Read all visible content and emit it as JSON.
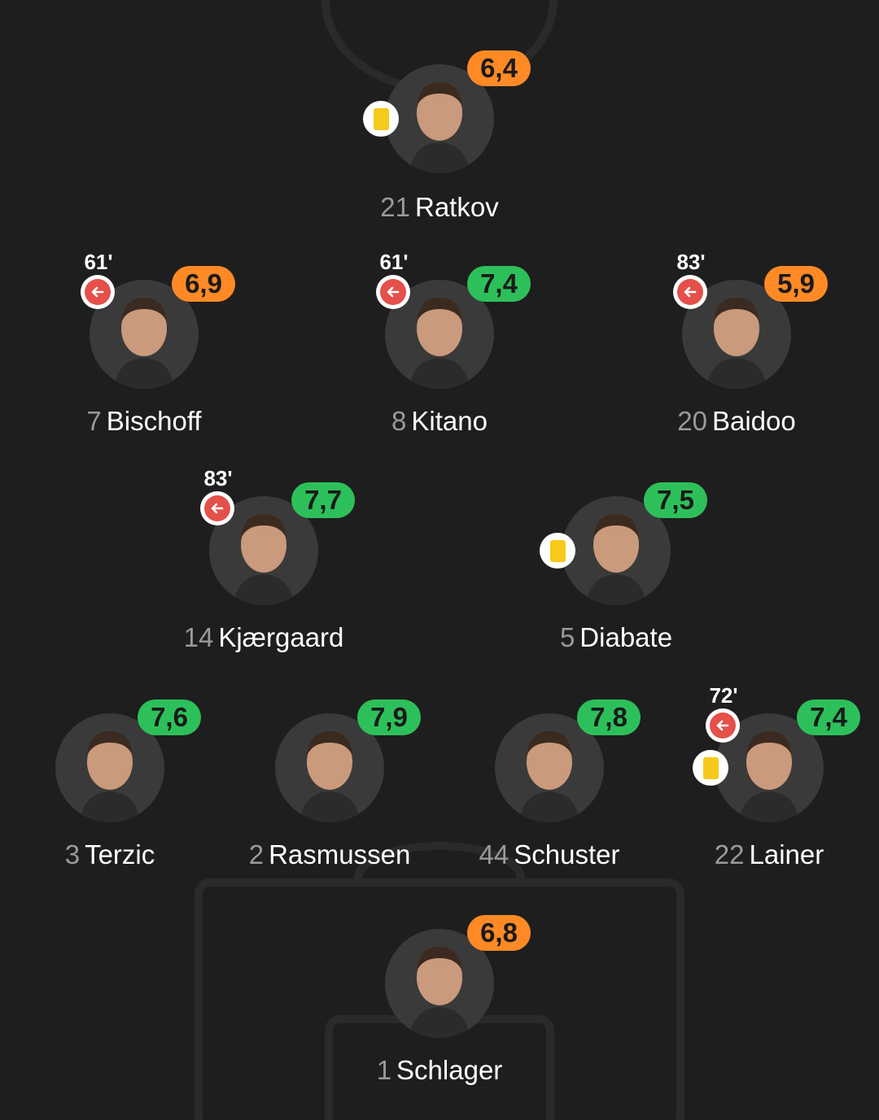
{
  "colors": {
    "background": "#1e1e1e",
    "rating_good": "#2dc05a",
    "rating_average": "#ff8a25",
    "sub_out": "#e4504a",
    "yellow_card": "#f7c91b",
    "number_text": "#9a9a9a"
  },
  "icons": {
    "substitution": "arrow-left-icon",
    "yellow_card": "yellow-card-icon"
  },
  "players": {
    "ratkov": {
      "number": "21",
      "name": "Ratkov",
      "rating": "6,4",
      "yellow_card": true
    },
    "bischoff": {
      "number": "7",
      "name": "Bischoff",
      "rating": "6,9",
      "sub_minute": "61'"
    },
    "kitano": {
      "number": "8",
      "name": "Kitano",
      "rating": "7,4",
      "sub_minute": "61'"
    },
    "baidoo": {
      "number": "20",
      "name": "Baidoo",
      "rating": "5,9",
      "sub_minute": "83'"
    },
    "kjaergaard": {
      "number": "14",
      "name": "Kjærgaard",
      "rating": "7,7",
      "sub_minute": "83'"
    },
    "diabate": {
      "number": "5",
      "name": "Diabate",
      "rating": "7,5",
      "yellow_card": true
    },
    "terzic": {
      "number": "3",
      "name": "Terzic",
      "rating": "7,6"
    },
    "rasmussen": {
      "number": "2",
      "name": "Rasmussen",
      "rating": "7,9"
    },
    "schuster": {
      "number": "44",
      "name": "Schuster",
      "rating": "7,8"
    },
    "lainer": {
      "number": "22",
      "name": "Lainer",
      "rating": "7,4",
      "sub_minute": "72'",
      "yellow_card": true
    },
    "schlager": {
      "number": "1",
      "name": "Schlager",
      "rating": "6,8"
    }
  }
}
